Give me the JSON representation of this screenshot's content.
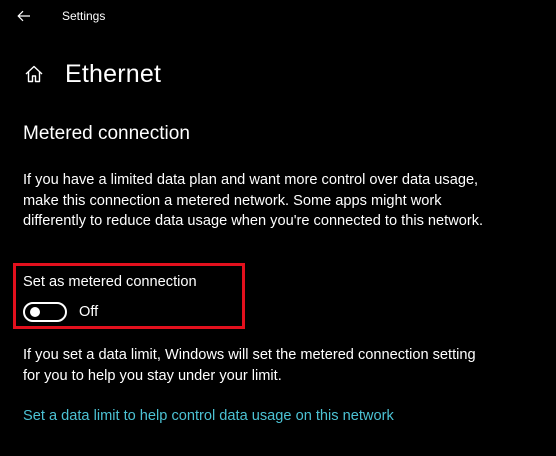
{
  "window": {
    "app_title": "Settings",
    "back_icon": "back-arrow-icon"
  },
  "header": {
    "home_icon": "home-icon",
    "title": "Ethernet"
  },
  "metered_section": {
    "title": "Metered connection",
    "description": "If you have a limited data plan and want more control over data usage, make this connection a metered network. Some apps might work differently to reduce data usage when you're connected to this network.",
    "toggle": {
      "label": "Set as metered connection",
      "state_label": "Off",
      "is_on": false
    },
    "info_text": "If you set a data limit, Windows will set the metered connection setting for you to help you stay under your limit.",
    "data_limit_link": "Set a data limit to help control data usage on this network"
  },
  "colors": {
    "background": "#000000",
    "text": "#ffffff",
    "link": "#4cc2d4",
    "highlight_border": "#e3101d"
  }
}
